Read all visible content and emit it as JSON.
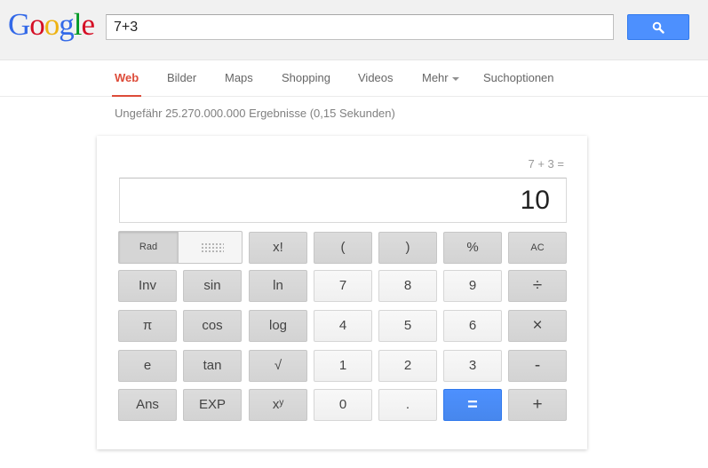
{
  "logo": {
    "text": "Google",
    "letters": [
      "G",
      "o",
      "o",
      "g",
      "l",
      "e"
    ],
    "colors": [
      "#3369e8",
      "#d50f25",
      "#eeb211",
      "#3369e8",
      "#009925",
      "#d50f25"
    ]
  },
  "search": {
    "value": "7+3",
    "button_icon": "search-icon",
    "button_color": "#4d90fe"
  },
  "nav": {
    "items": [
      {
        "label": "Web",
        "active": true
      },
      {
        "label": "Bilder"
      },
      {
        "label": "Maps"
      },
      {
        "label": "Shopping"
      },
      {
        "label": "Videos"
      },
      {
        "label": "Mehr"
      },
      {
        "label": "Suchoptionen"
      }
    ],
    "accent": "#dd4b39"
  },
  "result_stats": "Ungefähr 25.270.000.000 Ergebnisse (0,15 Sekunden)",
  "calculator": {
    "history": "7 + 3 =",
    "display": "10",
    "mode_label": "Rad",
    "keys": {
      "fact": "x!",
      "lparen": "(",
      "rparen": ")",
      "percent": "%",
      "ac": "AC",
      "inv": "Inv",
      "sin": "sin",
      "ln": "ln",
      "seven": "7",
      "eight": "8",
      "nine": "9",
      "divide": "÷",
      "pi": "π",
      "cos": "cos",
      "log": "log",
      "four": "4",
      "five": "5",
      "six": "6",
      "multiply": "×",
      "e": "e",
      "tan": "tan",
      "sqrt": "√",
      "one": "1",
      "two": "2",
      "three": "3",
      "minus": "-",
      "ans": "Ans",
      "exp": "EXP",
      "pow": "xʸ",
      "zero": "0",
      "dot": ".",
      "equals": "=",
      "plus": "+"
    }
  }
}
